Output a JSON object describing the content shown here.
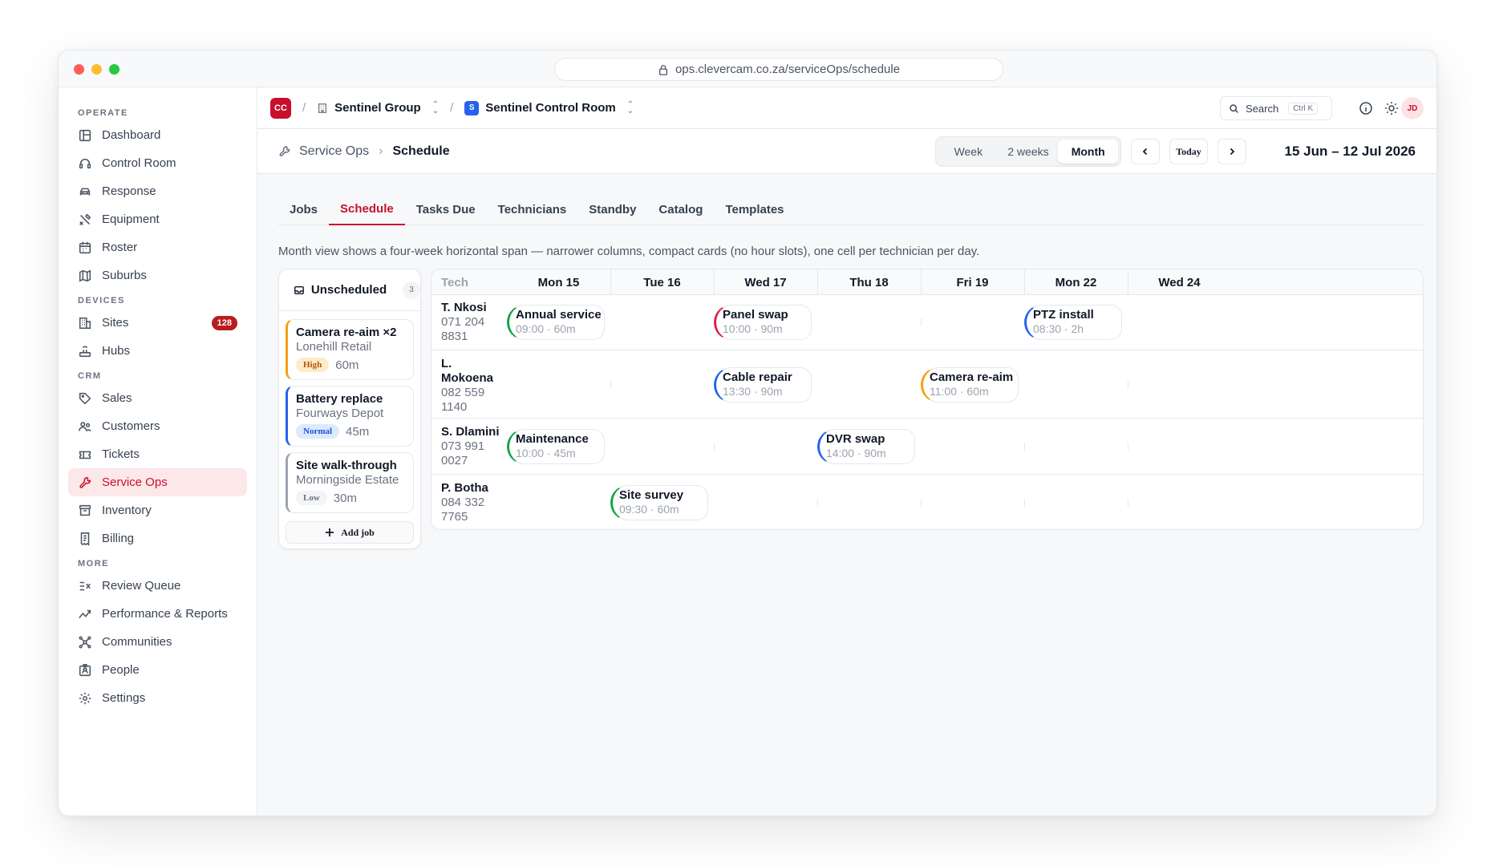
{
  "browser": {
    "url": "ops.clevercam.co.za/serviceOps/schedule"
  },
  "sidebar": {
    "sections": [
      {
        "label": "OPERATE",
        "items": [
          {
            "label": "Dashboard",
            "icon": "dashboard-icon"
          },
          {
            "label": "Control Room",
            "icon": "headset-icon"
          },
          {
            "label": "Response",
            "icon": "car-icon"
          },
          {
            "label": "Equipment",
            "icon": "tools-icon"
          },
          {
            "label": "Roster",
            "icon": "calendar-icon"
          },
          {
            "label": "Suburbs",
            "icon": "map-icon"
          }
        ]
      },
      {
        "label": "DEVICES",
        "items": [
          {
            "label": "Sites",
            "icon": "building-icon",
            "badge": "128"
          },
          {
            "label": "Hubs",
            "icon": "router-icon"
          }
        ]
      },
      {
        "label": "CRM",
        "items": [
          {
            "label": "Sales",
            "icon": "tag-icon"
          },
          {
            "label": "Customers",
            "icon": "users-icon"
          },
          {
            "label": "Tickets",
            "icon": "ticket-icon"
          },
          {
            "label": "Service Ops",
            "icon": "wrench-icon",
            "active": true
          },
          {
            "label": "Inventory",
            "icon": "archive-icon"
          },
          {
            "label": "Billing",
            "icon": "receipt-icon"
          }
        ]
      },
      {
        "label": "MORE",
        "items": [
          {
            "label": "Review Queue",
            "icon": "review-list-icon"
          },
          {
            "label": "Performance & Reports",
            "icon": "trend-icon"
          },
          {
            "label": "Communities",
            "icon": "network-icon"
          },
          {
            "label": "People",
            "icon": "id-card-icon"
          },
          {
            "label": "Settings",
            "icon": "gear-icon"
          }
        ]
      }
    ]
  },
  "topbar": {
    "logo": "CC",
    "org": "Sentinel Group",
    "workspace_logo": "S",
    "workspace": "Sentinel Control Room",
    "search_label": "Search",
    "search_shortcut": "Ctrl K",
    "avatar": "JD"
  },
  "subbar": {
    "parent": "Service Ops",
    "current": "Schedule",
    "views": [
      "Week",
      "2 weeks",
      "Month"
    ],
    "active_view": "Month",
    "today_label": "Today",
    "range": "15 Jun – 12 Jul 2026"
  },
  "tabs": [
    "Jobs",
    "Schedule",
    "Tasks Due",
    "Technicians",
    "Standby",
    "Catalog",
    "Templates"
  ],
  "active_tab": "Schedule",
  "description": "Month view shows a four-week horizontal span — narrower columns, compact cards (no hour slots), one cell per technician per day.",
  "colors": {
    "accent": "#c8102e",
    "high": "#f59e0b",
    "normal": "#2563eb",
    "low": "#9ca3af",
    "green": "#16a34a",
    "red": "#e11d48",
    "orange": "#f59e0b",
    "blue": "#2563eb"
  },
  "unscheduled": {
    "title": "Unscheduled",
    "count": "3",
    "add_label": "Add job",
    "jobs": [
      {
        "title": "Camera re-aim ×2",
        "site": "Lonehill Retail",
        "priority": "High",
        "duration": "60m",
        "color": "#f59e0b"
      },
      {
        "title": "Battery replace",
        "site": "Fourways Depot",
        "priority": "Normal",
        "duration": "45m",
        "color": "#2563eb"
      },
      {
        "title": "Site walk-through",
        "site": "Morningside Estate",
        "priority": "Low",
        "duration": "30m",
        "color": "#9ca3af"
      }
    ]
  },
  "schedule": {
    "tech_header": "Tech",
    "days": [
      "Mon 15",
      "Tue 16",
      "Wed 17",
      "Thu 18",
      "Fri 19",
      "Mon 22",
      "Wed 24"
    ],
    "technicians": [
      {
        "name": "T. Nkosi",
        "phone": [
          "071 204",
          "8831"
        ],
        "jobs": [
          {
            "day": 0,
            "title": "Annual service",
            "meta": "09:00 · 60m",
            "color": "#16a34a"
          },
          {
            "day": 2,
            "title": "Panel swap",
            "meta": "10:00 · 90m",
            "color": "#e11d48"
          },
          {
            "day": 5,
            "title": "PTZ install",
            "meta": "08:30 · 2h",
            "color": "#2563eb"
          }
        ]
      },
      {
        "name": "L. Mokoena",
        "phone": [
          "082 559",
          "1140"
        ],
        "jobs": [
          {
            "day": 2,
            "title": "Cable repair",
            "meta": "13:30 · 90m",
            "color": "#2563eb"
          },
          {
            "day": 4,
            "title": "Camera re-aim",
            "meta": "11:00 · 60m",
            "color": "#f59e0b"
          }
        ]
      },
      {
        "name": "S. Dlamini",
        "phone": [
          "073 991",
          "0027"
        ],
        "jobs": [
          {
            "day": 0,
            "title": "Maintenance",
            "meta": "10:00 · 45m",
            "color": "#16a34a"
          },
          {
            "day": 3,
            "title": "DVR swap",
            "meta": "14:00 · 90m",
            "color": "#2563eb"
          }
        ]
      },
      {
        "name": "P. Botha",
        "phone": [
          "084 332",
          "7765"
        ],
        "jobs": [
          {
            "day": 1,
            "title": "Site survey",
            "meta": "09:30 · 60m",
            "color": "#16a34a"
          }
        ]
      }
    ]
  }
}
